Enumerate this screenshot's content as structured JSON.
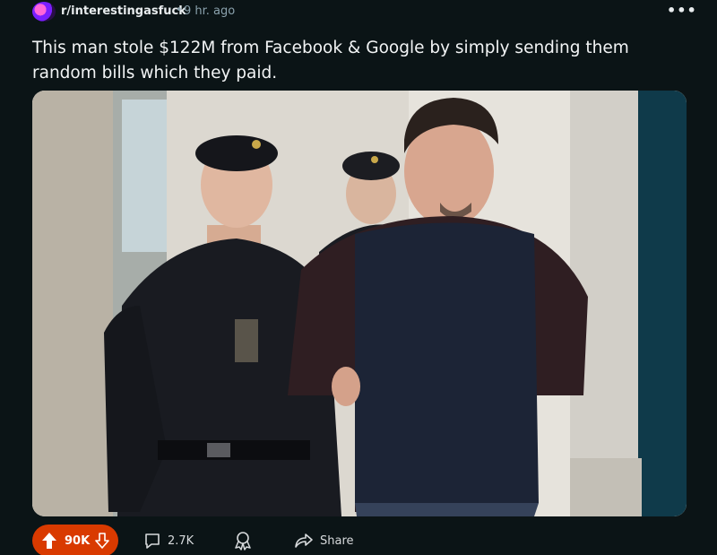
{
  "post": {
    "subreddit": "r/interestingasfuck",
    "separator": "•",
    "time_ago": "9 hr. ago",
    "more_label": "•••",
    "title": "This man stole $122M from Facebook & Google by simply sending them random bills which they paid.",
    "image_alt": "Man in a dark sweater with hands behind his back escorted by two uniformed guards in black berets"
  },
  "actions": {
    "upvotes": "90K",
    "comments": "2.7K",
    "share_label": "Share"
  },
  "colors": {
    "background": "#0b1416",
    "upvote_active": "#d93a00",
    "text": "#d7dadc"
  },
  "icons": {
    "subreddit": "subreddit-avatar",
    "upvote": "arrow-up-icon",
    "downvote": "arrow-down-icon",
    "comment": "comment-bubble-icon",
    "award": "award-ribbon-icon",
    "share": "share-arrow-icon"
  }
}
